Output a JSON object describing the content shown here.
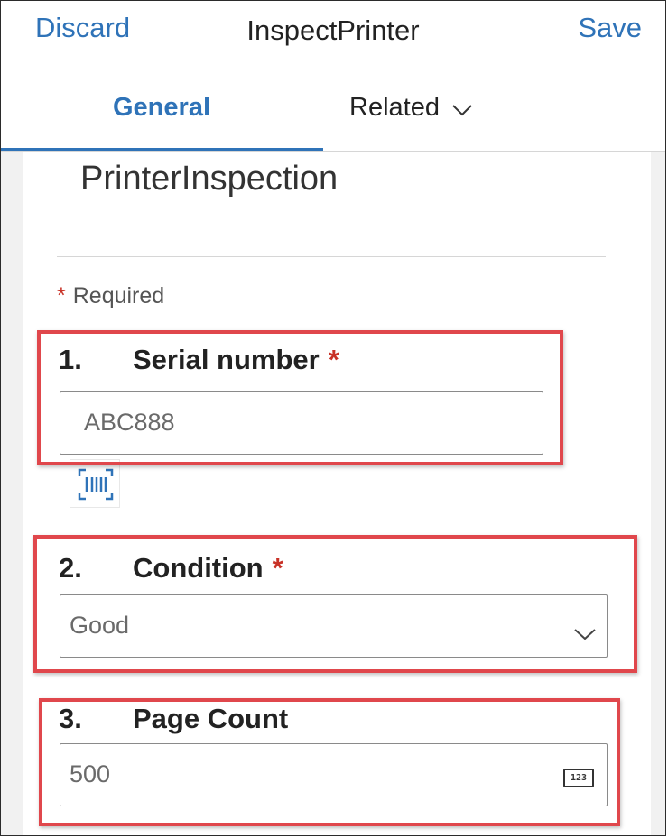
{
  "header": {
    "discard_label": "Discard",
    "title": "InspectPrinter",
    "save_label": "Save"
  },
  "tabs": [
    {
      "label": "General",
      "active": true
    },
    {
      "label": "Related",
      "active": false
    }
  ],
  "form": {
    "title": "PrinterInspection",
    "required_star": "*",
    "required_text": "Required",
    "fields": [
      {
        "number": "1.",
        "label": "Serial number",
        "required_star": "*",
        "value": "ABC888",
        "type": "text",
        "extra_icon": "barcode-scan-icon"
      },
      {
        "number": "2.",
        "label": "Condition",
        "required_star": "*",
        "value": "Good",
        "type": "dropdown"
      },
      {
        "number": "3.",
        "label": "Page Count",
        "value": "500",
        "type": "number",
        "icon_text": "123"
      }
    ]
  },
  "colors": {
    "accent": "#2f73b8",
    "required": "#c83227",
    "highlight_box": "#e0474c"
  }
}
